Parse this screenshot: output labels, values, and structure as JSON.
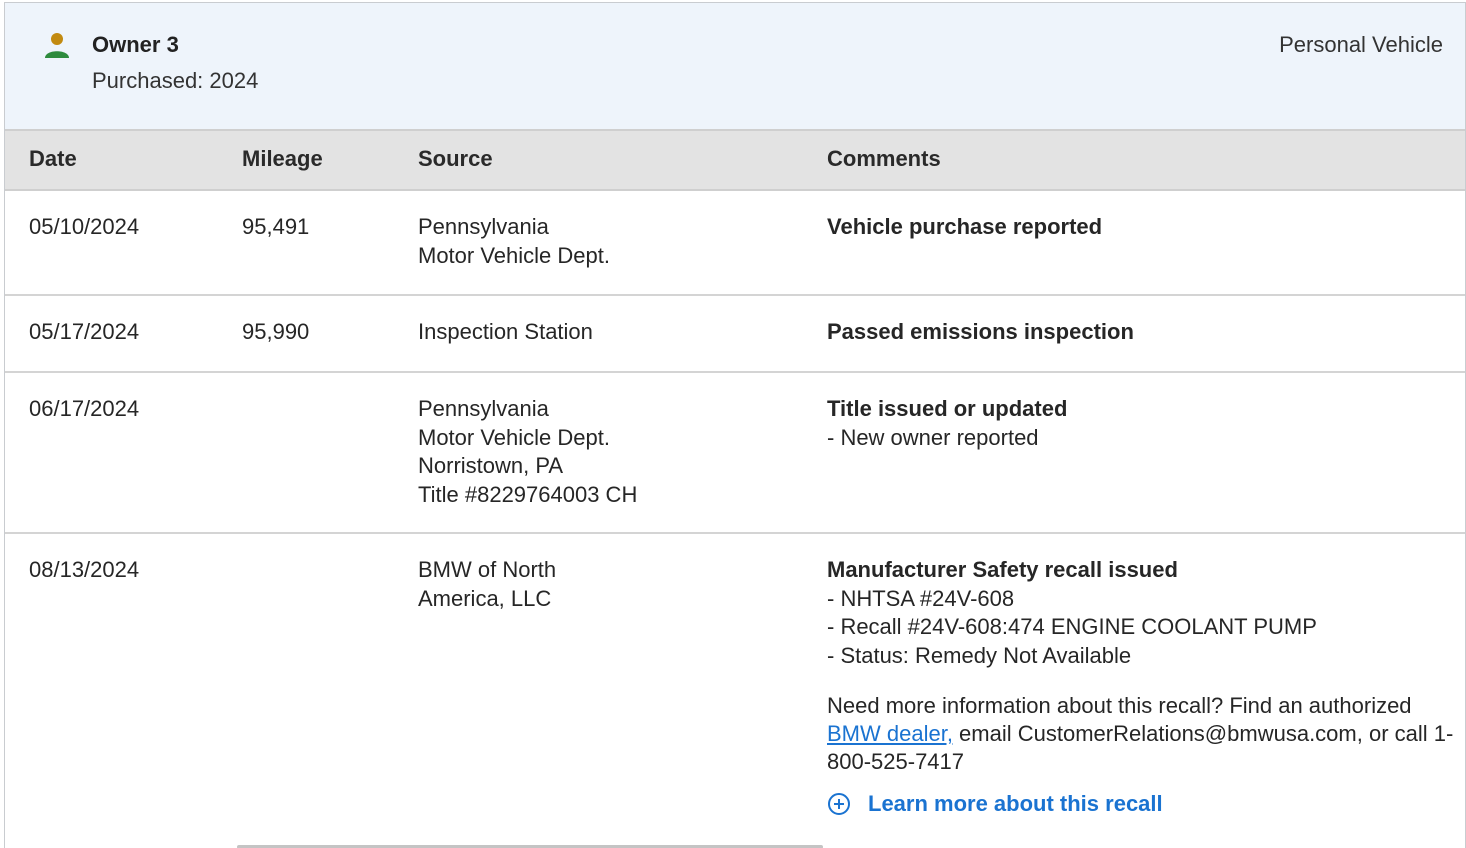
{
  "owner": {
    "name": "Owner 3",
    "purchased": "Purchased: 2024",
    "vehicle_type": "Personal Vehicle",
    "icon": "person-icon",
    "icon_colors": {
      "head": "#c28a10",
      "body": "#2e8b3e"
    }
  },
  "table": {
    "headers": {
      "date": "Date",
      "mileage": "Mileage",
      "source": "Source",
      "comments": "Comments"
    },
    "rows": [
      {
        "date": "05/10/2024",
        "mileage": "95,491",
        "source": [
          "Pennsylvania",
          "Motor Vehicle Dept."
        ],
        "comment_title": "Vehicle purchase reported"
      },
      {
        "date": "05/17/2024",
        "mileage": "95,990",
        "source": [
          "Inspection Station"
        ],
        "comment_title": "Passed emissions inspection"
      },
      {
        "date": "06/17/2024",
        "mileage": "",
        "source": [
          "Pennsylvania",
          "Motor Vehicle Dept.",
          "Norristown, PA",
          "Title #8229764003 CH"
        ],
        "comment_title": "Title issued or updated",
        "comment_bullets": [
          "- New owner reported"
        ]
      },
      {
        "date": "08/13/2024",
        "mileage": "",
        "source": [
          "BMW of North",
          "America, LLC"
        ],
        "comment_title": "Manufacturer Safety recall issued",
        "comment_bullets": [
          "- NHTSA #24V-608",
          "- Recall #24V-608:474 ENGINE COOLANT PUMP",
          "- Status: Remedy Not Available"
        ],
        "note_before_link": "Need more information about this recall? Find an authorized ",
        "note_link": "BMW dealer,",
        "note_after_link": " email CustomerRelations@bmwusa.com, or call 1-800-525-7417",
        "learn_more": "Learn more about this recall",
        "learn_more_icon": "plus-circle-icon"
      }
    ]
  },
  "colors": {
    "link": "#1a73d1",
    "header_bg": "#eef4fb",
    "table_head_bg": "#e3e3e3"
  }
}
